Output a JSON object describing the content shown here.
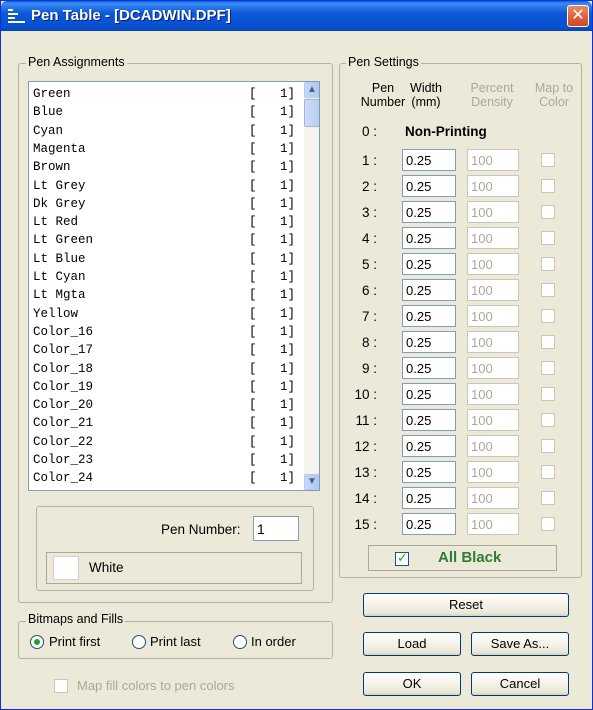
{
  "window": {
    "title": "Pen Table - [DCADWIN.DPF]",
    "close_glyph": "✕",
    "icon": "app-menu-icon"
  },
  "pen_assignments": {
    "legend": "Pen Assignments",
    "items": [
      {
        "name": "Green",
        "value": "1"
      },
      {
        "name": "Blue",
        "value": "1"
      },
      {
        "name": "Cyan",
        "value": "1"
      },
      {
        "name": "Magenta",
        "value": "1"
      },
      {
        "name": "Brown",
        "value": "1"
      },
      {
        "name": "Lt Grey",
        "value": "1"
      },
      {
        "name": "Dk Grey",
        "value": "1"
      },
      {
        "name": "Lt Red",
        "value": "1"
      },
      {
        "name": "Lt Green",
        "value": "1"
      },
      {
        "name": "Lt Blue",
        "value": "1"
      },
      {
        "name": "Lt Cyan",
        "value": "1"
      },
      {
        "name": "Lt Mgta",
        "value": "1"
      },
      {
        "name": "Yellow",
        "value": "1"
      },
      {
        "name": "Color_16",
        "value": "1"
      },
      {
        "name": "Color_17",
        "value": "1"
      },
      {
        "name": "Color_18",
        "value": "1"
      },
      {
        "name": "Color_19",
        "value": "1"
      },
      {
        "name": "Color_20",
        "value": "1"
      },
      {
        "name": "Color_21",
        "value": "1"
      },
      {
        "name": "Color_22",
        "value": "1"
      },
      {
        "name": "Color_23",
        "value": "1"
      },
      {
        "name": "Color_24",
        "value": "1"
      }
    ],
    "open_bracket": "[",
    "close_bracket": "]",
    "pen_number_label": "Pen Number:",
    "pen_number_value": "1",
    "color_name": "White",
    "color_swatch": "#ffffff"
  },
  "pen_settings": {
    "legend": "Pen Settings",
    "headers": {
      "pen": "Pen",
      "number": "Number",
      "width": "Width",
      "width_unit": "(mm)",
      "percent": "Percent",
      "density": "Density",
      "map_to": "Map to",
      "color": "Color"
    },
    "pen0_label": "0 :",
    "pen0_text": "Non-Printing",
    "rows": [
      {
        "label": "1 :",
        "width": "0.25",
        "density": "100"
      },
      {
        "label": "2 :",
        "width": "0.25",
        "density": "100"
      },
      {
        "label": "3 :",
        "width": "0.25",
        "density": "100"
      },
      {
        "label": "4 :",
        "width": "0.25",
        "density": "100"
      },
      {
        "label": "5 :",
        "width": "0.25",
        "density": "100"
      },
      {
        "label": "6 :",
        "width": "0.25",
        "density": "100"
      },
      {
        "label": "7 :",
        "width": "0.25",
        "density": "100"
      },
      {
        "label": "8 :",
        "width": "0.25",
        "density": "100"
      },
      {
        "label": "9 :",
        "width": "0.25",
        "density": "100"
      },
      {
        "label": "10 :",
        "width": "0.25",
        "density": "100"
      },
      {
        "label": "11 :",
        "width": "0.25",
        "density": "100"
      },
      {
        "label": "12 :",
        "width": "0.25",
        "density": "100"
      },
      {
        "label": "13 :",
        "width": "0.25",
        "density": "100"
      },
      {
        "label": "14 :",
        "width": "0.25",
        "density": "100"
      },
      {
        "label": "15 :",
        "width": "0.25",
        "density": "100"
      }
    ],
    "all_black_label": "All Black",
    "all_black_checked": true,
    "all_black_color": "#2e7d32"
  },
  "bitmaps": {
    "legend": "Bitmaps and Fills",
    "options": [
      "Print first",
      "Print last",
      "In order"
    ],
    "selected": "Print first",
    "map_fill_label": "Map fill colors to pen colors"
  },
  "buttons": {
    "reset": "Reset",
    "load": "Load",
    "save_as": "Save As...",
    "ok": "OK",
    "cancel": "Cancel"
  },
  "colors": {
    "title_bar": "#0a5fe0",
    "dialog_bg": "#ece9d8",
    "radio_dot": "#21a121",
    "check_mark": "#21a121"
  }
}
